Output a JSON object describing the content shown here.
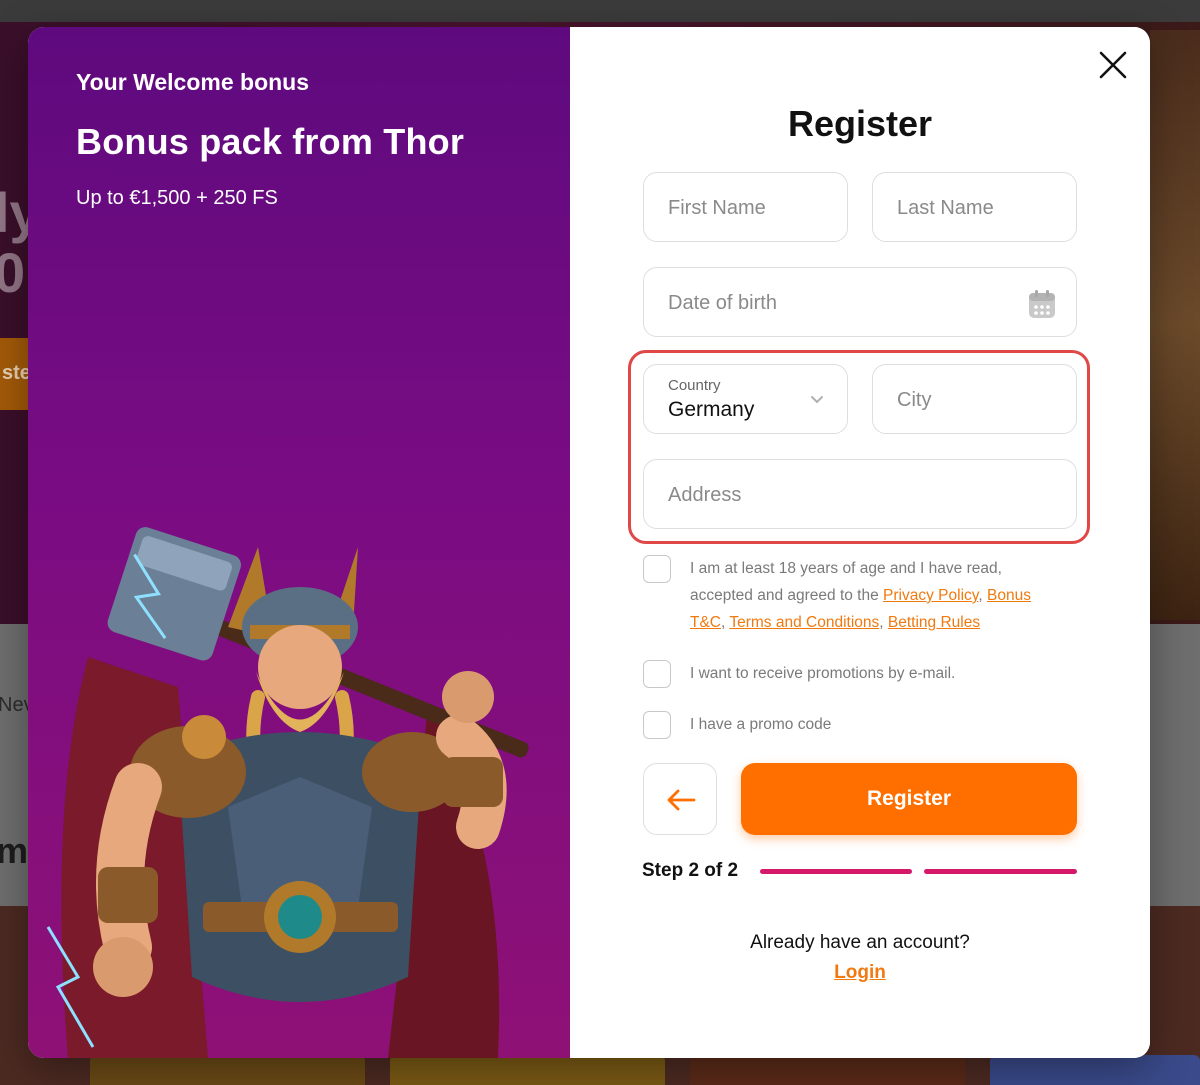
{
  "background": {
    "hero_fragment_1": "ly",
    "hero_fragment_2": "0",
    "hero_button_fragment": "ste",
    "mid_fragment": "Nev",
    "section_fragment": "m"
  },
  "promo": {
    "kicker": "Your Welcome bonus",
    "title": "Bonus pack from Thor",
    "subtitle": "Up to €1,500 + 250 FS"
  },
  "form": {
    "title": "Register",
    "first_name_placeholder": "First Name",
    "last_name_placeholder": "Last Name",
    "dob_placeholder": "Date of birth",
    "country_label": "Country",
    "country_value": "Germany",
    "city_placeholder": "City",
    "address_placeholder": "Address",
    "consent": {
      "text_prefix": "I am at least 18 years of age and I have read, accepted and agreed to the ",
      "privacy": "Privacy Policy",
      "sep1": ", ",
      "bonus_tc": "Bonus T&C",
      "sep2": ", ",
      "terms": "Terms and Conditions",
      "sep3": ", ",
      "betting": "Betting Rules"
    },
    "promotions_label": "I want to receive promotions by e-mail.",
    "promo_code_label": "I have a promo code",
    "register_button": "Register",
    "step_label": "Step 2 of 2",
    "already_text": "Already have an account?",
    "login_link": "Login"
  },
  "colors": {
    "accent": "#ff6f00",
    "link": "#f07a10",
    "progress": "#d6186a",
    "highlight": "#e04848",
    "promo_top": "#5e0a7e",
    "promo_bottom": "#8e1176"
  },
  "progress": {
    "current_step": 2,
    "total_steps": 2
  }
}
